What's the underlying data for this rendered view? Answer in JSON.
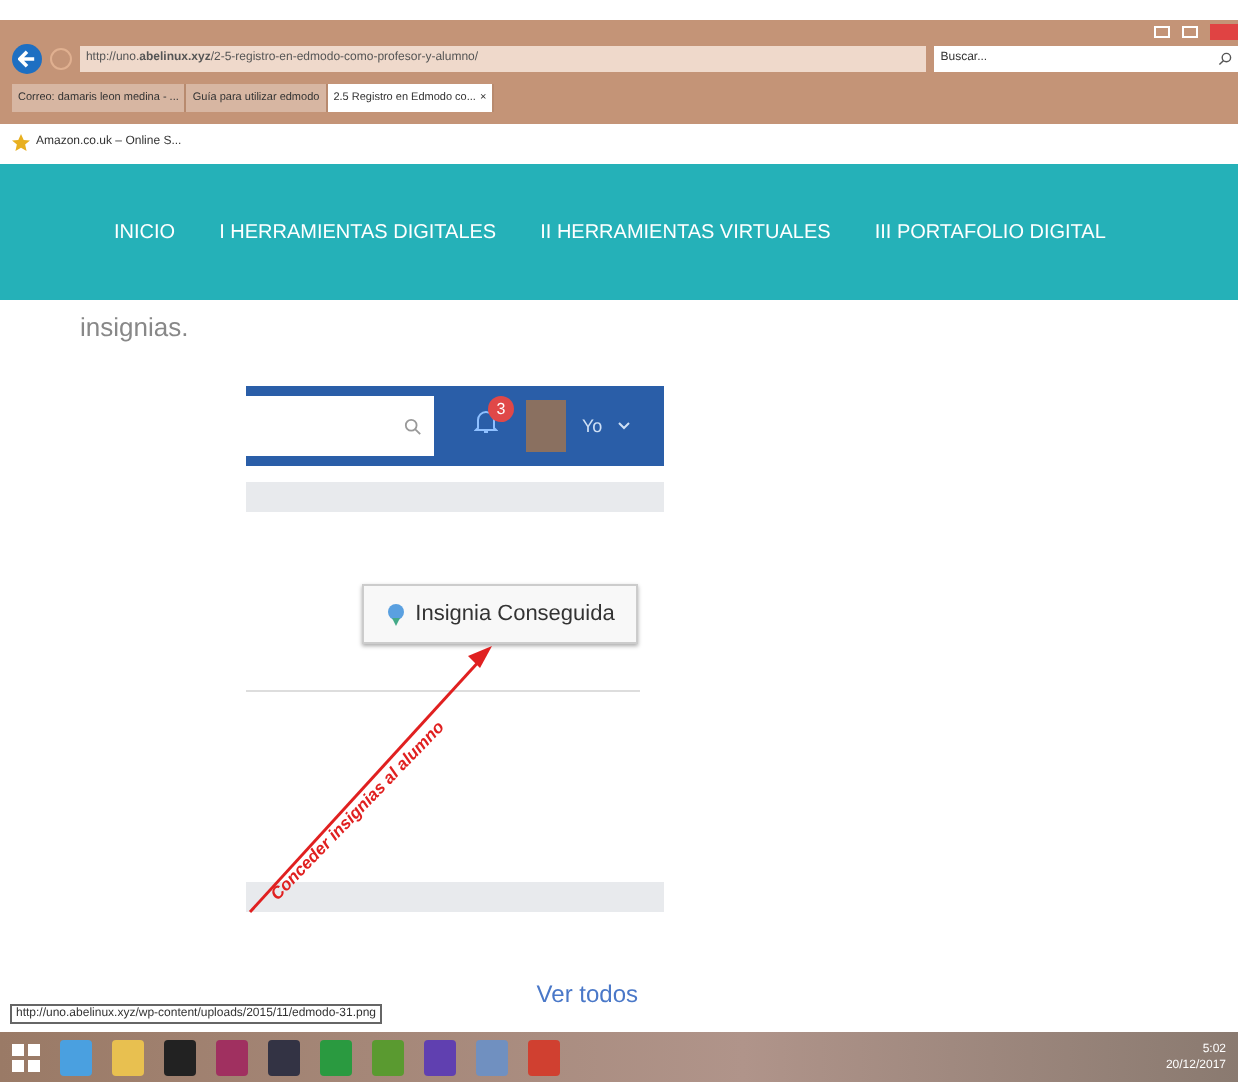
{
  "browser": {
    "address": {
      "prefix": "http://uno.",
      "domain": "abelinux.xyz",
      "path": "/2-5-registro-en-edmodo-como-profesor-y-alumno/"
    },
    "search": {
      "placeholder": "Buscar..."
    },
    "tabs": [
      {
        "label": "Correo: damaris leon medina - ...",
        "selected": false
      },
      {
        "label": "Guía para utilizar edmodo",
        "selected": false
      },
      {
        "label": "2.5 Registro en Edmodo co...",
        "selected": true,
        "close": "×"
      }
    ],
    "favorites": [
      {
        "label": "Amazon.co.uk – Online S..."
      }
    ]
  },
  "nav": {
    "items": [
      {
        "label": "INICIO"
      },
      {
        "label": "I HERRAMIENTAS DIGITALES"
      },
      {
        "label": "II HERRAMIENTAS VIRTUALES"
      },
      {
        "label": "III PORTAFOLIO DIGITAL"
      }
    ]
  },
  "content": {
    "text": "insignias.",
    "figure": {
      "notification_count": "3",
      "user": "Yo",
      "badge_button": "Insignia Conseguida",
      "annotation": "Conceder insignias al alumno"
    },
    "link": "Ver todos"
  },
  "status_url": "http://uno.abelinux.xyz/wp-content/uploads/2015/11/edmodo-31.png",
  "taskbar": {
    "time": "5:02",
    "date": "20/12/2017"
  }
}
